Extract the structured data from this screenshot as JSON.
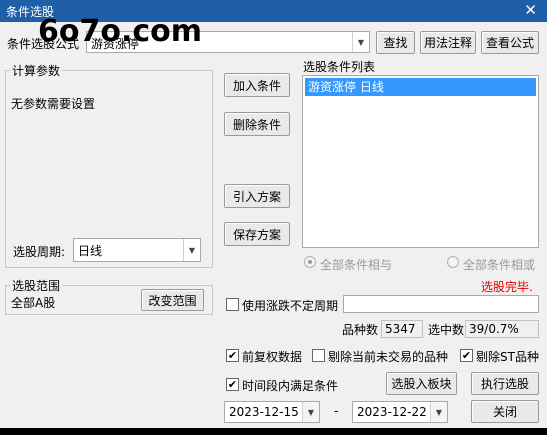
{
  "window": {
    "title": "条件选股",
    "close_glyph": "✕",
    "watermark": "6o7o.com"
  },
  "top": {
    "formula_label": "条件选股公式",
    "formula_value": "游资涨停",
    "find_button": "查找",
    "usage_button": "用法注释",
    "view_formula_button": "查看公式"
  },
  "params": {
    "legend": "计算参数",
    "message": "无参数需要设置",
    "period_label": "选股周期:",
    "period_value": "日线"
  },
  "actions": {
    "add_condition": "加入条件",
    "delete_condition": "删除条件",
    "import_scheme": "引入方案",
    "save_scheme": "保存方案"
  },
  "conditions": {
    "list_label": "选股条件列表",
    "items": [
      "游资涨停  日线"
    ],
    "radio_and": "全部条件相与",
    "radio_or": "全部条件相或",
    "status": "选股完毕."
  },
  "range": {
    "legend": "选股范围",
    "value": "全部A股",
    "change_button": "改变范围"
  },
  "options": {
    "use_uncertain_period": "使用涨跌不定周期",
    "stock_count_label": "品种数",
    "stock_count_value": "5347",
    "selected_count_label": "选中数",
    "selected_count_value": "39/0.7%",
    "pre_adjusted": "前复权数据",
    "exclude_untraded": "剔除当前未交易的品种",
    "exclude_st": "剔除ST品种",
    "time_range": "时间段内满足条件",
    "check_mark": "✔",
    "combo_arrow": "▼"
  },
  "footer": {
    "add_to_block": "选股入板块",
    "execute": "执行选股",
    "close": "关闭",
    "date_from": "2023-12-15",
    "date_sep": "-",
    "date_to": "2023-12-22"
  },
  "colors": {
    "titlebar": "#1e5fa8",
    "selection": "#3399ff",
    "status": "#e00000"
  }
}
